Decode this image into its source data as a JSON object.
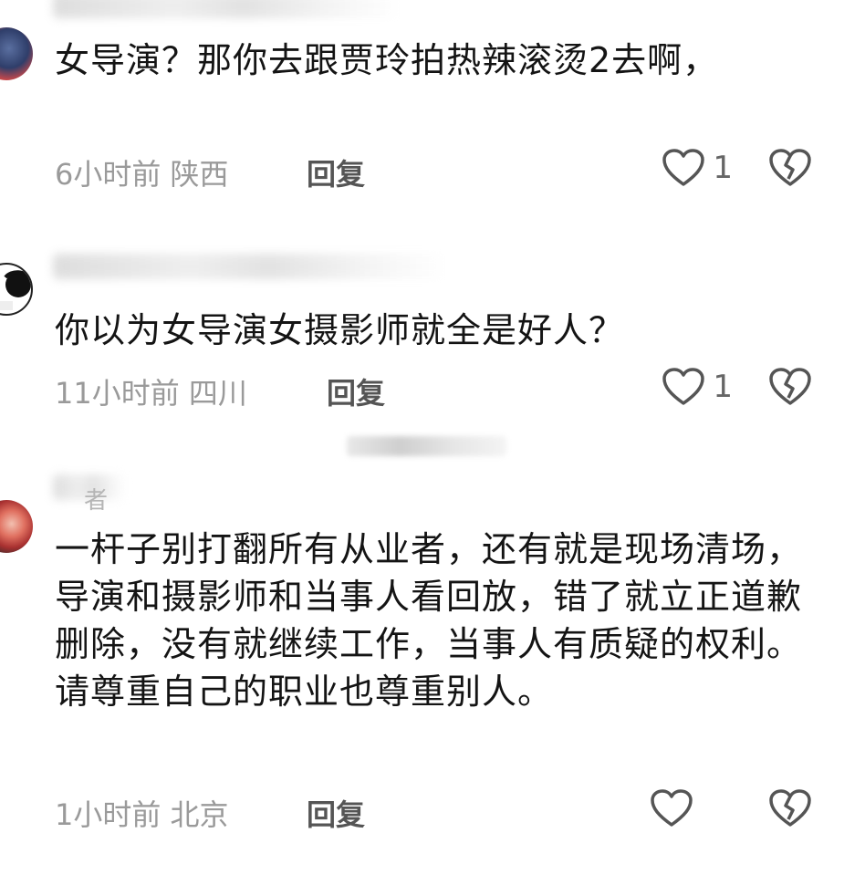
{
  "comments": [
    {
      "text": "女导演？那你去跟贾玲拍热辣滚烫2去啊，",
      "time": "6小时前",
      "location": "陕西",
      "reply_label": "回复",
      "likes": "1"
    },
    {
      "text": "你以为女导演女摄影师就全是好人？",
      "time": "11小时前",
      "location": "四川",
      "reply_label": "回复",
      "likes": "1"
    },
    {
      "username_partial": "者",
      "text": "一杆子别打翻所有从业者，还有就是现场清场，导演和摄影师和当事人看回放，错了就立正道歉删除，没有就继续工作，当事人有质疑的权利。请尊重自己的职业也尊重别人。",
      "time": "1小时前",
      "location": "北京",
      "reply_label": "回复",
      "likes": ""
    }
  ],
  "colors": {
    "text": "#141414",
    "meta": "#9a9a9a",
    "icon": "#555555"
  },
  "icons": [
    "heart-outline-icon",
    "broken-heart-icon"
  ]
}
